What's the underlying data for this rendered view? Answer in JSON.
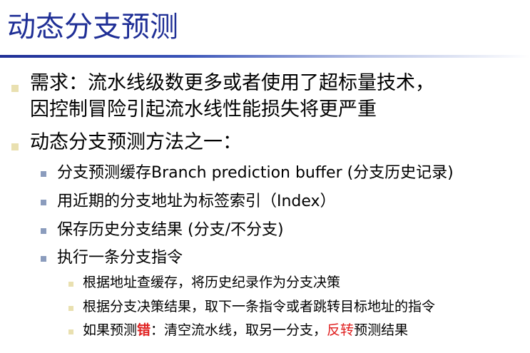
{
  "title": "动态分支预测",
  "colors": {
    "title": "#1f2f96",
    "bullet_l1": "#e9e0b0",
    "bullet_l2": "#8b9cbd",
    "bullet_l3": "#e9e0b0",
    "emphasis": "#e02020"
  },
  "bullets": [
    {
      "line1": "需求：流水线级数更多或者使用了超标量技术，",
      "line2": "因控制冒险引起流水线性能损失将更严重"
    },
    {
      "text": "动态分支预测方法之一：",
      "children": [
        {
          "text": "分支预测缓存Branch prediction buffer (分支历史记录)"
        },
        {
          "text": "用近期的分支地址为标签索引（Index）"
        },
        {
          "text": "保存历史分支结果 (分支/不分支)"
        },
        {
          "text": "执行一条分支指令",
          "children": [
            {
              "text": "根据地址查缓存，将历史纪录作为分支决策"
            },
            {
              "text": "根据分支决策结果，取下一条指令或者跳转目标地址的指令"
            },
            {
              "part1": "如果预测",
              "part2": "错",
              "part3": "：清空流水线，取另一分支，",
              "part4": "反转",
              "part5": "预测结果"
            }
          ]
        }
      ]
    }
  ]
}
